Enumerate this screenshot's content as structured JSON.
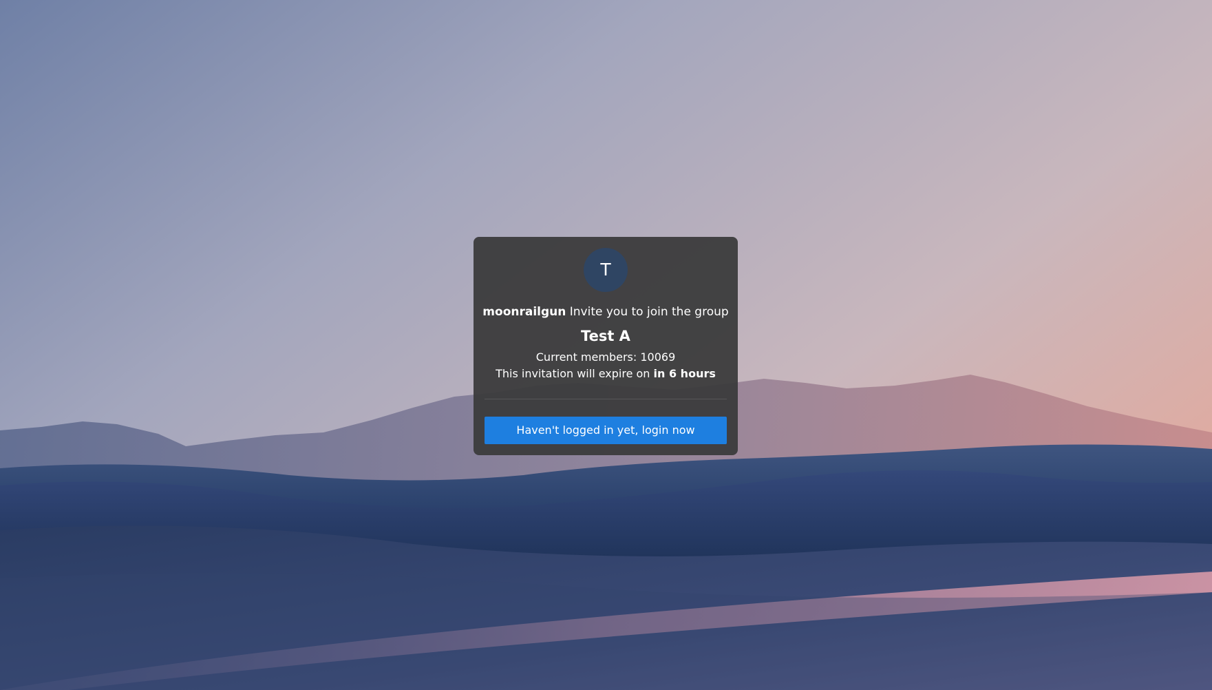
{
  "invite": {
    "avatar_letter": "T",
    "inviter": "moonrailgun",
    "invite_text": " Invite you to join the group",
    "group_name": "Test A",
    "members_label": "Current members: ",
    "members_count": "10069",
    "expire_label": "This invitation will expire on ",
    "expire_value": "in 6 hours",
    "login_button": "Haven't logged in yet, login now"
  },
  "colors": {
    "card_bg": "#3a3a3c",
    "avatar_bg": "#2f4563",
    "button_bg": "#1e7fe0",
    "text": "#ffffff"
  },
  "background": {
    "icon": "desert-dunes-wallpaper"
  }
}
